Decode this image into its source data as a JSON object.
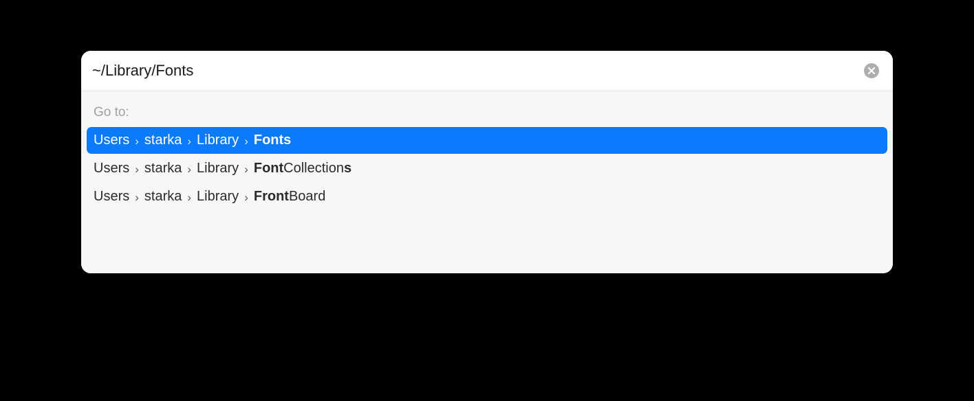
{
  "input": {
    "value": "~/Library/Fonts"
  },
  "goto_label": "Go to:",
  "results": [
    {
      "selected": true,
      "segments": [
        {
          "parts": [
            {
              "t": "Users",
              "b": false
            }
          ]
        },
        {
          "parts": [
            {
              "t": "starka",
              "b": false
            }
          ]
        },
        {
          "parts": [
            {
              "t": "Library",
              "b": false
            }
          ]
        },
        {
          "parts": [
            {
              "t": "Fonts",
              "b": true
            }
          ]
        }
      ]
    },
    {
      "selected": false,
      "segments": [
        {
          "parts": [
            {
              "t": "Users",
              "b": false
            }
          ]
        },
        {
          "parts": [
            {
              "t": "starka",
              "b": false
            }
          ]
        },
        {
          "parts": [
            {
              "t": "Library",
              "b": false
            }
          ]
        },
        {
          "parts": [
            {
              "t": "Font",
              "b": true
            },
            {
              "t": "Collection",
              "b": false
            },
            {
              "t": "s",
              "b": true
            }
          ]
        }
      ]
    },
    {
      "selected": false,
      "segments": [
        {
          "parts": [
            {
              "t": "Users",
              "b": false
            }
          ]
        },
        {
          "parts": [
            {
              "t": "starka",
              "b": false
            }
          ]
        },
        {
          "parts": [
            {
              "t": "Library",
              "b": false
            }
          ]
        },
        {
          "parts": [
            {
              "t": "Fr",
              "b": true
            },
            {
              "t": "ont",
              "b": true
            },
            {
              "t": "Board",
              "b": false
            }
          ]
        }
      ]
    }
  ]
}
